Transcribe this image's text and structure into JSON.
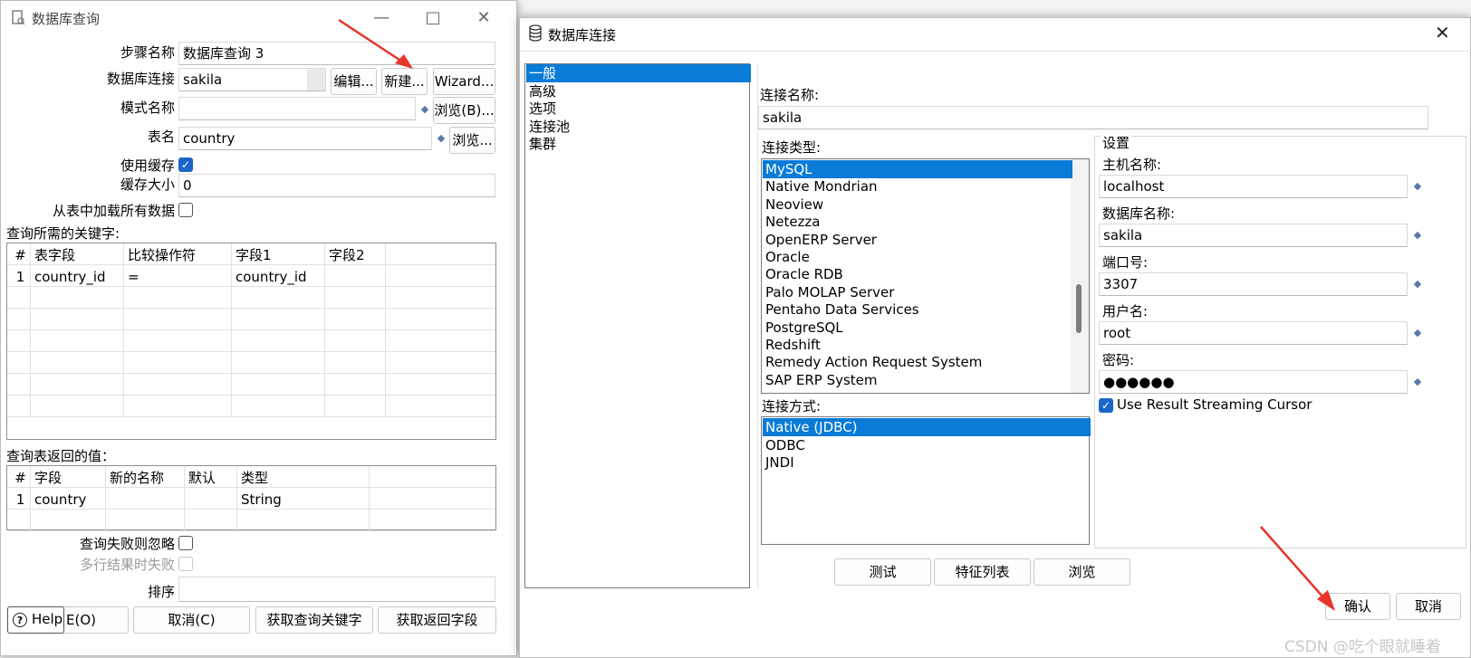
{
  "left_dialog": {
    "title": "数据库查询",
    "step_name_label": "步骤名称",
    "step_name_value": "数据库查询 3",
    "connection_label": "数据库连接",
    "connection_value": "sakila",
    "edit_label": "编辑...",
    "new_label": "新建...",
    "wizard_label": "Wizard...",
    "schema_label": "模式名称",
    "schema_value": "",
    "browse_schema_label": "浏览(B)...",
    "table_label": "表名",
    "table_value": "country",
    "browse_table_label": "浏览...",
    "use_cache_label": "使用缓存",
    "use_cache_checked": true,
    "cache_size_label": "缓存大小",
    "cache_size_value": "0",
    "load_all_label": "从表中加载所有数据",
    "keys_section_label": "查询所需的关键字:",
    "keys_table": {
      "headers": [
        "#",
        "表字段",
        "比较操作符",
        "字段1",
        "字段2"
      ],
      "rows": [
        [
          "1",
          "country_id",
          "=",
          "country_id",
          ""
        ]
      ]
    },
    "return_section_label": "查询表返回的值：",
    "return_table": {
      "headers": [
        "#",
        "字段",
        "新的名称",
        "默认",
        "类型"
      ],
      "rows": [
        [
          "1",
          "country",
          "",
          "",
          "String"
        ]
      ]
    },
    "ignore_fail_label": "查询失败则忽略",
    "multi_fail_label": "多行结果时失败",
    "order_label": "排序",
    "help_label": "Help",
    "ok_partial_label": "E(O)",
    "cancel_label": "取消(C)",
    "get_keys_label": "获取查询关键字",
    "get_fields_label": "获取返回字段"
  },
  "right_dialog": {
    "title": "数据库连接",
    "nav_items": [
      "一般",
      "高级",
      "选项",
      "连接池",
      "集群"
    ],
    "nav_selected": 0,
    "conn_name_label": "连接名称:",
    "conn_name_value": "sakila",
    "conn_type_label": "连接类型:",
    "conn_types": [
      "MySQL",
      "Native Mondrian",
      "Neoview",
      "Netezza",
      "OpenERP Server",
      "Oracle",
      "Oracle RDB",
      "Palo MOLAP Server",
      "Pentaho Data Services",
      "PostgreSQL",
      "Redshift",
      "Remedy Action Request System",
      "SAP ERP System"
    ],
    "conn_type_selected": 0,
    "access_label": "连接方式:",
    "access_types": [
      "Native (JDBC)",
      "ODBC",
      "JNDI"
    ],
    "access_selected": 0,
    "settings_label": "设置",
    "host_label": "主机名称:",
    "host_value": "localhost",
    "db_label": "数据库名称:",
    "db_value": "sakila",
    "port_label": "端口号:",
    "port_value": "3307",
    "user_label": "用户名:",
    "user_value": "root",
    "pwd_label": "密码:",
    "pwd_value": "●●●●●●",
    "streaming_label": "Use Result Streaming Cursor",
    "streaming_checked": true,
    "test_label": "测试",
    "features_label": "特征列表",
    "browse_label": "浏览",
    "confirm_label": "确认",
    "cancel_label": "取消"
  },
  "watermark": "CSDN @吃个眼就睡着",
  "colors": {
    "selection": "#0a7bd7",
    "arrow": "#e8342a",
    "checkbox": "#1a66c9"
  }
}
